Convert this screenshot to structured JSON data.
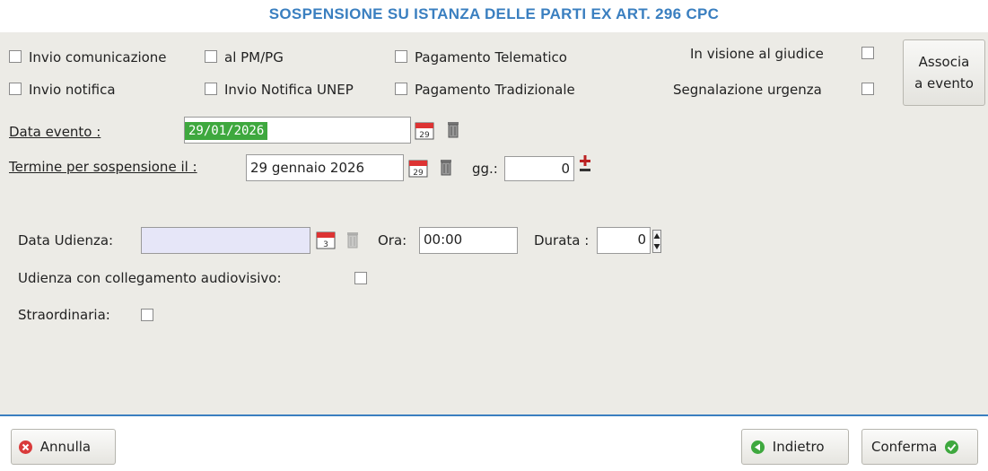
{
  "title": "SOSPENSIONE SU ISTANZA DELLE PARTI EX ART. 296 CPC",
  "options": {
    "invio_comunicazione": "Invio comunicazione",
    "al_pm_pg": "al PM/PG",
    "pagamento_telematico": "Pagamento Telematico",
    "in_visione_giudice": "In visione al giudice",
    "invio_notifica": "Invio notifica",
    "invio_notifica_unep": "Invio Notifica UNEP",
    "pagamento_tradizionale": "Pagamento Tradizionale",
    "segnalazione_urgenza": "Segnalazione urgenza"
  },
  "associa_button": {
    "line1": "Associa",
    "line2": "a evento"
  },
  "data_evento": {
    "label": "Data evento :",
    "value": "29/01/2026"
  },
  "termine": {
    "label": "Termine per sospensione il :",
    "value": "29 gennaio 2026",
    "gg_label": "gg.:",
    "gg_value": "0"
  },
  "udienza": {
    "data_label": "Data Udienza:",
    "data_value": "",
    "ora_label": "Ora:",
    "ora_value": "00:00",
    "durata_label": "Durata :",
    "durata_value": "0",
    "collegamento_label": "Udienza con collegamento audiovisivo:",
    "straordinaria_label": "Straordinaria:"
  },
  "calendar_icons": {
    "top_day": "29",
    "udienza_day": "3"
  },
  "footer": {
    "annulla": "Annulla",
    "indietro": "Indietro",
    "conferma": "Conferma"
  },
  "colors": {
    "title": "#3a7fc0",
    "selection": "#3ea83e",
    "cancel": "#d93a3a",
    "ok": "#3ea83e",
    "udienza_field": "#e6e6f8"
  }
}
